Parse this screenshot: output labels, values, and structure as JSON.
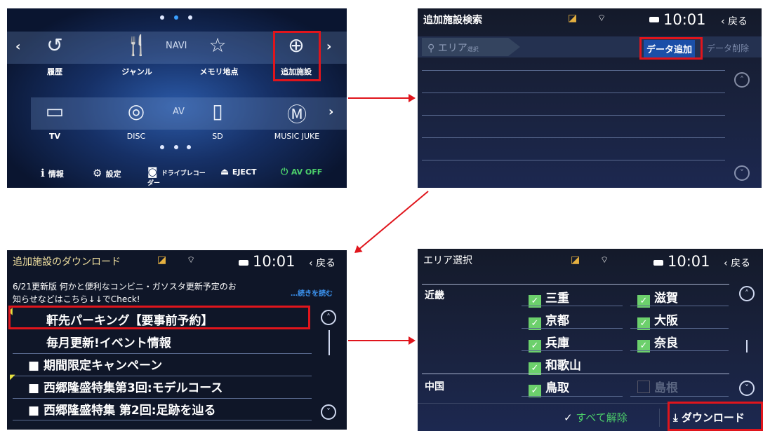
{
  "menu_screen": {
    "navi_label": "NAVI",
    "av_label": "AV",
    "navi_items": [
      {
        "label": "履歴",
        "icon": "history-icon"
      },
      {
        "label": "ジャンル",
        "icon": "restaurant-icon"
      },
      {
        "label": "メモリ地点",
        "icon": "star-icon"
      },
      {
        "label": "追加施設",
        "icon": "add-facility-icon"
      }
    ],
    "av_items": [
      {
        "label": "TV",
        "icon": "tv-icon"
      },
      {
        "label": "DISC",
        "icon": "disc-icon"
      },
      {
        "label": "SD",
        "icon": "sd-card-icon"
      },
      {
        "label": "MUSIC JUKE",
        "icon": "music-juke-icon"
      }
    ],
    "bottom": [
      {
        "label": "情報",
        "icon": "info-icon"
      },
      {
        "label": "設定",
        "icon": "gear-icon"
      },
      {
        "label": "ドライブレコーダー",
        "icon": "drive-recorder-icon"
      },
      {
        "label": "EJECT",
        "icon": "eject-icon"
      },
      {
        "label": "AV OFF",
        "icon": "power-icon"
      }
    ]
  },
  "search_screen": {
    "title": "追加施設検索",
    "time": "10:01",
    "back": "戻る",
    "area_tab": "エリア",
    "area_sub": "選択",
    "add_data": "データ追加",
    "delete_data": "データ削除"
  },
  "download_screen": {
    "title": "追加施設のダウンロード",
    "time": "10:01",
    "back": "戻る",
    "notice_line1": "6/21更新版 何かと便利なコンビニ・ガソスタ更新予定のお",
    "notice_line2": "知らせなどはこちら↓↓でCheck!",
    "read_more": "…続きを読む",
    "items": [
      {
        "label": "軒先パーキング【要事前予約】",
        "folder": false,
        "new": true
      },
      {
        "label": "毎月更新!イベント情報",
        "folder": false,
        "new": false
      },
      {
        "label": "期間限定キャンペーン",
        "folder": true,
        "new": false
      },
      {
        "label": "西郷隆盛特集第3回:モデルコース",
        "folder": true,
        "new": true
      },
      {
        "label": "西郷隆盛特集 第2回:足跡を辿る",
        "folder": true,
        "new": false
      }
    ]
  },
  "area_screen": {
    "title": "エリア選択",
    "time": "10:01",
    "back": "戻る",
    "regions": [
      {
        "name": "近畿"
      },
      {
        "name": "中国"
      }
    ],
    "prefs": [
      {
        "label": "三重",
        "checked": true
      },
      {
        "label": "滋賀",
        "checked": true
      },
      {
        "label": "京都",
        "checked": true
      },
      {
        "label": "大阪",
        "checked": true
      },
      {
        "label": "兵庫",
        "checked": true
      },
      {
        "label": "奈良",
        "checked": true
      },
      {
        "label": "和歌山",
        "checked": true
      },
      {
        "label": "鳥取",
        "checked": true
      },
      {
        "label": "島根",
        "checked": false
      }
    ],
    "clear_all": "すべて解除",
    "download": "ダウンロード"
  },
  "colors": {
    "highlight": "#e0151c",
    "check": "#6cd06c",
    "link": "#3a8ee8",
    "accent_green": "#4ccf6a"
  }
}
